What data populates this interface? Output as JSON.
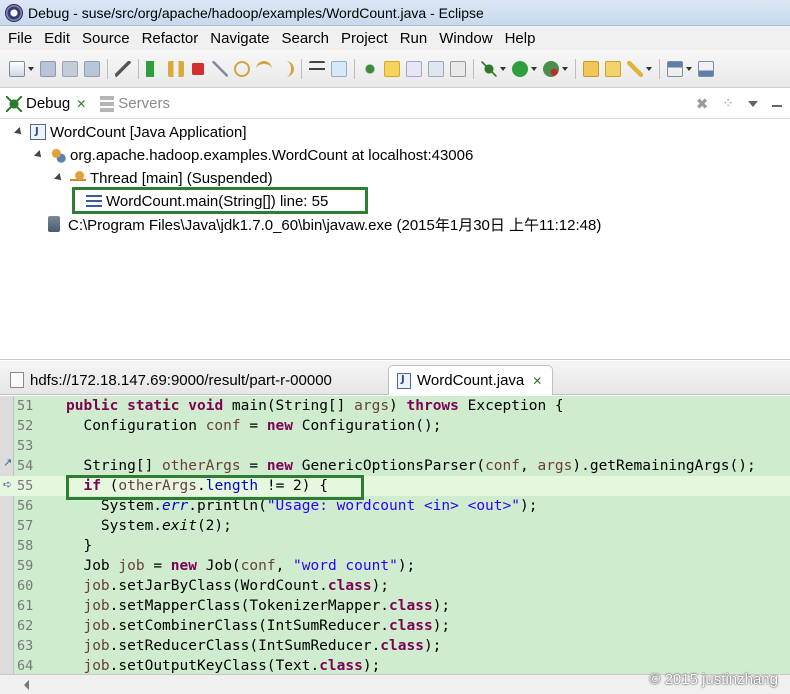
{
  "window": {
    "title": "Debug - suse/src/org/apache/hadoop/examples/WordCount.java - Eclipse"
  },
  "menu": [
    "File",
    "Edit",
    "Source",
    "Refactor",
    "Navigate",
    "Search",
    "Project",
    "Run",
    "Window",
    "Help"
  ],
  "debug_view": {
    "tabs": [
      {
        "label": "Debug",
        "active": true
      },
      {
        "label": "Servers",
        "active": false
      }
    ],
    "tree": [
      {
        "label": "WordCount [Java Application]",
        "indent": 0
      },
      {
        "label": "org.apache.hadoop.examples.WordCount at localhost:43006",
        "indent": 1
      },
      {
        "label": "Thread [main] (Suspended)",
        "indent": 2
      },
      {
        "label": "WordCount.main(String[]) line: 55",
        "indent": 3
      },
      {
        "label": "C:\\Program Files\\Java\\jdk1.7.0_60\\bin\\javaw.exe (2015年1月30日 上午11:12:48)",
        "indent": 1
      }
    ]
  },
  "editor": {
    "tabs": [
      {
        "label": "hdfs://172.18.147.69:9000/result/part-r-00000",
        "active": false
      },
      {
        "label": "WordCount.java",
        "active": true
      }
    ],
    "lines": [
      {
        "num": "51",
        "text": "public static void main(String[] args) throws Exception {"
      },
      {
        "num": "52",
        "text": "  Configuration conf = new Configuration();"
      },
      {
        "num": "53",
        "text": ""
      },
      {
        "num": "54",
        "text": "  String[] otherArgs = new GenericOptionsParser(conf, args).getRemainingArgs();"
      },
      {
        "num": "55",
        "text": "  if (otherArgs.length != 2) {"
      },
      {
        "num": "56",
        "text": "    System.err.println(\"Usage: wordcount <in> <out>\");"
      },
      {
        "num": "57",
        "text": "    System.exit(2);"
      },
      {
        "num": "58",
        "text": "  }"
      },
      {
        "num": "59",
        "text": "  Job job = new Job(conf, \"word count\");"
      },
      {
        "num": "60",
        "text": "  job.setJarByClass(WordCount.class);"
      },
      {
        "num": "61",
        "text": "  job.setMapperClass(TokenizerMapper.class);"
      },
      {
        "num": "62",
        "text": "  job.setCombinerClass(IntSumReducer.class);"
      },
      {
        "num": "63",
        "text": "  job.setReducerClass(IntSumReducer.class);"
      },
      {
        "num": "64",
        "text": "  job.setOutputKeyClass(Text.class);"
      }
    ]
  },
  "watermark": "© 2015 justinzhang",
  "colors": {
    "code_bg": "#cfeccf",
    "keyword": "#7f0055",
    "string": "#2a00ff",
    "highlight_box": "#2e7d32"
  }
}
